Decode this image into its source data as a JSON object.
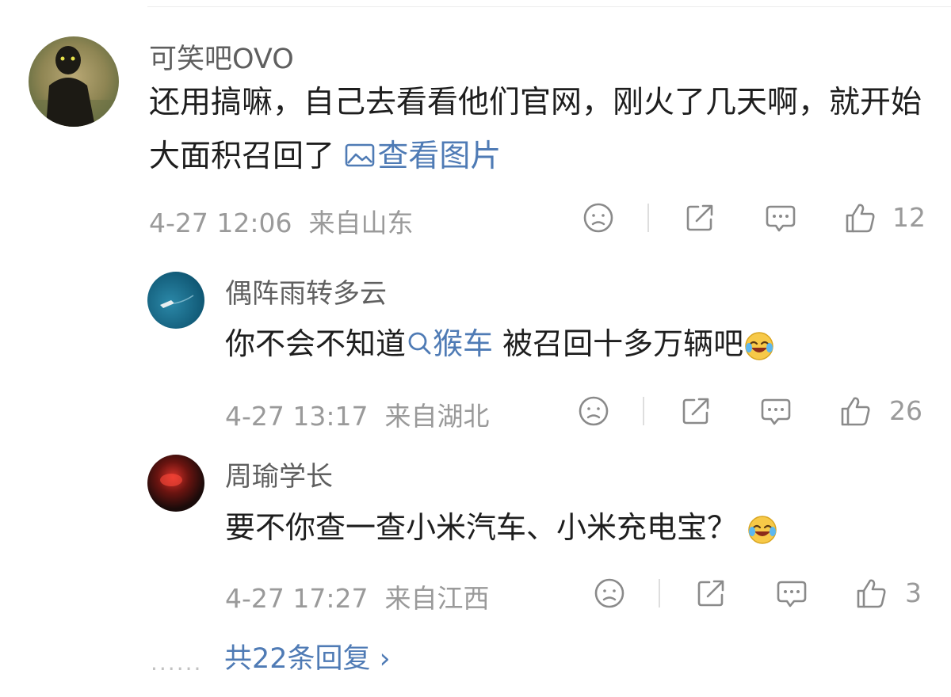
{
  "main_comment": {
    "username": "可笑吧OVO",
    "text_before_link": "还用搞嘛，自己去看看他们官网，刚火了几天啊，就开始大面积召回了 ",
    "link_icon": "image-icon",
    "link_label": "查看图片",
    "time": "4-27 12:06",
    "location": "来自山东",
    "like_count": "12"
  },
  "replies": [
    {
      "username": "偶阵雨转多云",
      "text_before_link": "你不会不知道",
      "link_icon": "search-icon",
      "link_label": "猴车",
      "text_after_link": " 被召回十多万辆吧",
      "emoji": "laugh-cry-emoji",
      "time": "4-27 13:17",
      "location": "来自湖北",
      "like_count": "26"
    },
    {
      "username": "周瑜学长",
      "text": "要不你查一查小米汽车、小米充电宝？",
      "emoji": "laugh-cry-emoji",
      "time": "4-27 17:27",
      "location": "来自江西",
      "like_count": "3"
    }
  ],
  "more_replies": {
    "dots": "......",
    "label": "共22条回复 ›"
  },
  "colors": {
    "link": "#4f7bb5",
    "text": "#1e1e1e",
    "meta": "#9a9a9a",
    "username": "#5f5f5f"
  }
}
